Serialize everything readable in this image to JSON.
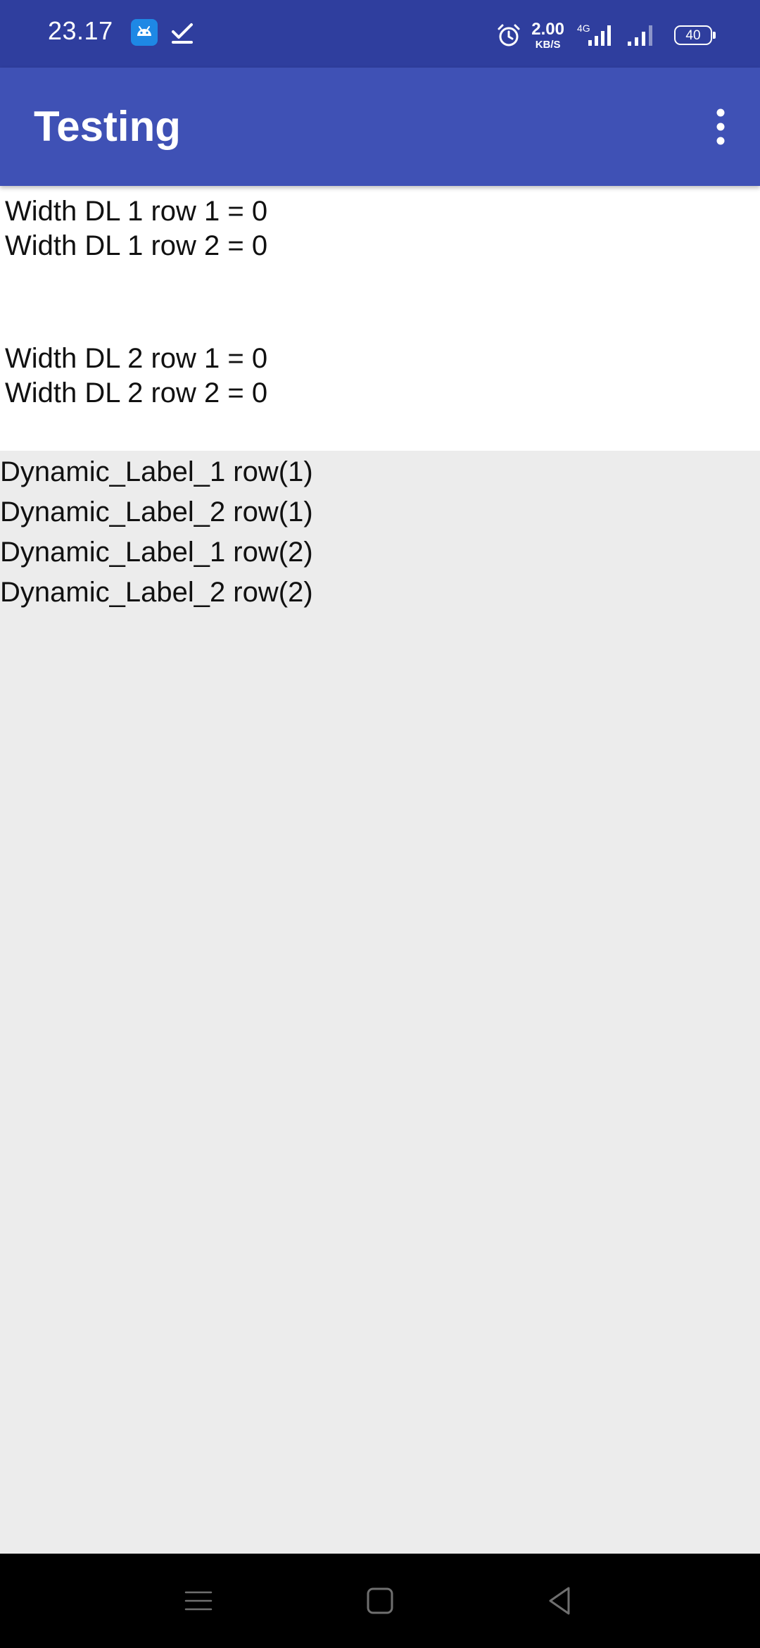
{
  "status_bar": {
    "time": "23.17",
    "app_icon": "android-notification-icon",
    "check_icon": "checkmark-icon",
    "alarm_icon": "alarm-clock-icon",
    "net_speed_value": "2.00",
    "net_speed_unit": "KB/S",
    "network_type": "4G",
    "signal_icons": [
      "signal-4g-icon",
      "signal-icon"
    ],
    "battery_level": "40",
    "background_color": "#2f3e9e"
  },
  "app_bar": {
    "title": "Testing",
    "overflow_icon": "more-vert-icon",
    "background_color": "#3f51b5"
  },
  "width_info": [
    "Width DL 1 row 1 = 0",
    "Width DL 1 row 2 = 0",
    "Width DL 2 row 1 = 0",
    "Width DL 2 row 2 = 0"
  ],
  "dynamic_labels": [
    "Dynamic_Label_1 row(1)",
    "Dynamic_Label_2 row(1)",
    "Dynamic_Label_1 row(2)",
    "Dynamic_Label_2 row(2)"
  ],
  "nav_bar": {
    "icons": [
      "menu-icon",
      "home-icon",
      "back-icon"
    ],
    "background_color": "#000000"
  },
  "colors": {
    "content_background": "#ececec",
    "panel_background": "#ffffff",
    "text": "#111111"
  }
}
